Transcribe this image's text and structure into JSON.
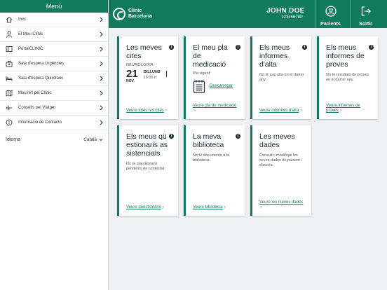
{
  "sidebar": {
    "header": "Menú",
    "items": [
      {
        "label": "Inici",
        "icon": "home-icon"
      },
      {
        "label": "El Meu Clínic",
        "icon": "person-icon"
      },
      {
        "label": "PortalCLINIC",
        "icon": "portal-icon"
      },
      {
        "label": "Sala d'espera Urgències",
        "icon": "emergency-icon"
      },
      {
        "label": "Sala d'espera Quiròfans",
        "icon": "bed-icon"
      },
      {
        "label": "Mou're't pel Clínic",
        "icon": "map-icon"
      },
      {
        "label": "Consells pel Viatger",
        "icon": "plane-icon"
      },
      {
        "label": "Informació de Contacto",
        "icon": "info-icon"
      }
    ],
    "language_label": "Idioma",
    "language_value": "Català"
  },
  "topbar": {
    "logo_line1": "Clínic",
    "logo_line2": "Barcelona",
    "user_name": "JOHN DOE",
    "user_id": "12345678P",
    "patients_label": "Pacients",
    "logout_label": "Sortir"
  },
  "cards": {
    "appointments": {
      "title": "Les meves cites",
      "specialty": "NEUROLOGIA",
      "day": "21",
      "month": "NOV.",
      "weekday": "DILLUNS",
      "time": "16:00 h",
      "link": "Veure totes les cites"
    },
    "medication": {
      "title": "El meu pla de medicació",
      "status": "Pla vigent",
      "download": "Descarregar",
      "link": "Veure pla de medicació"
    },
    "discharge": {
      "title": "Els meus informes d'alta",
      "text": "No té cap alta en el darrer any.",
      "link": "Veure informes d'alta"
    },
    "tests": {
      "title": "Els meus informes de proves",
      "text": "No té resultats de proves en el darrer any.",
      "link": "Veure informes de proves"
    },
    "questionnaires": {
      "title": "Els meus qüestionaris assistencials",
      "text": "No té qüestionaris pendents de contestar.",
      "link": "Veure qüestionaris"
    },
    "library": {
      "title": "La meva biblioteca",
      "text": "No té documents a la biblioteca.",
      "link": "Veure biblioteca"
    },
    "data": {
      "title": "Les meves dades",
      "text": "Consulti i modifiqui les seves dades de pacient i d'accés.",
      "link": "Veure les meves dades"
    }
  },
  "colors": {
    "brand": "#0f7a5c",
    "background": "#eef0f1"
  }
}
